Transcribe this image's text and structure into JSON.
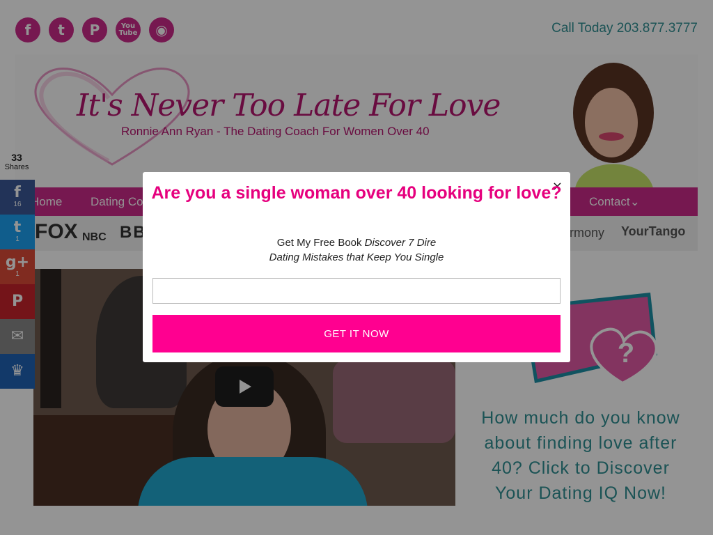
{
  "colors": {
    "brand_magenta": "#cc2a8a",
    "teal": "#2f8f93",
    "cta_pink": "#ff0090",
    "facebook": "#3b5998",
    "twitter": "#1da1f2",
    "google": "#dc4a38",
    "pinterest": "#c8232c",
    "email": "#888888",
    "sumome": "#1f63b5"
  },
  "top_social": [
    {
      "icon": "facebook-icon",
      "glyph": "f"
    },
    {
      "icon": "twitter-icon",
      "glyph": "t"
    },
    {
      "icon": "pinterest-icon",
      "glyph": "P"
    },
    {
      "icon": "youtube-icon",
      "glyph": "You Tube"
    },
    {
      "icon": "rss-icon",
      "glyph": "◉"
    }
  ],
  "call": "Call Today 203.877.3777",
  "header": {
    "title": "It's Never Too Late For Love",
    "subtitle": "Ronnie Ann Ryan - The Dating Coach For Women Over 40"
  },
  "nav": {
    "items": [
      "Home",
      "Dating Co",
      "Contact⌄"
    ]
  },
  "media": [
    "FOX",
    "NBC",
    "BBC",
    "rmony",
    "YourTango"
  ],
  "share": {
    "total": "33",
    "total_label": "Shares",
    "buttons": [
      {
        "icon": "facebook-icon",
        "glyph": "f",
        "count": "16"
      },
      {
        "icon": "twitter-icon",
        "glyph": "t",
        "count": "1"
      },
      {
        "icon": "google-plus-icon",
        "glyph": "g+",
        "count": "1"
      },
      {
        "icon": "pinterest-icon",
        "glyph": "P",
        "count": ""
      },
      {
        "icon": "email-icon",
        "glyph": "✉",
        "count": ""
      },
      {
        "icon": "crown-icon",
        "glyph": "♛",
        "count": ""
      }
    ]
  },
  "quiz": {
    "text": "How much do you know about finding love after 40? Click to Discover Your Dating IQ Now!"
  },
  "modal": {
    "close": "×",
    "title": "Are you a single woman over 40 looking for love?",
    "desc_prefix": "Get My Free Book ",
    "desc_italic_1": "Discover 7 Dire",
    "desc_italic_2": "Dating Mistakes that Keep You Single",
    "input_value": "",
    "button": "GET IT NOW"
  }
}
